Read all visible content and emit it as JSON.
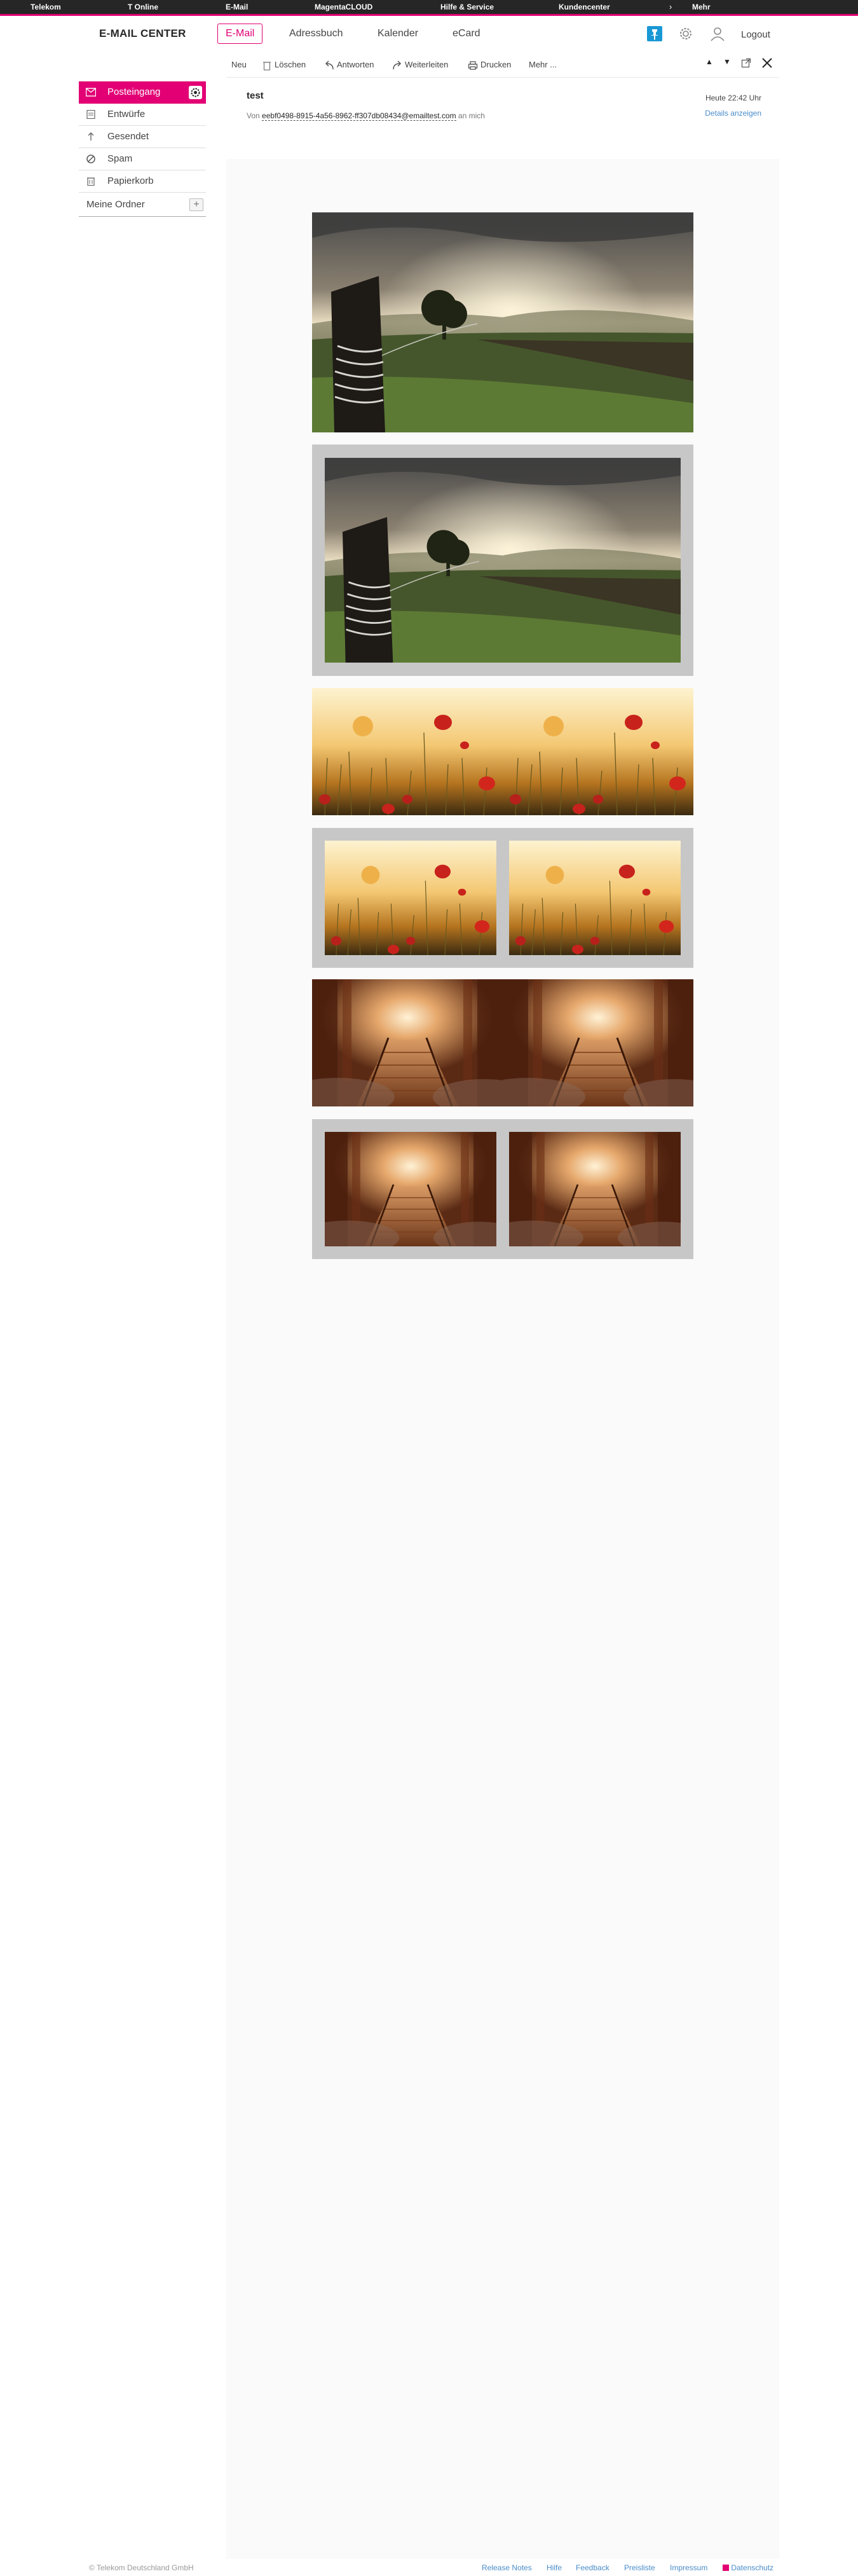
{
  "topbar": {
    "items": [
      "Telekom",
      "T Online",
      "E-Mail",
      "MagentaCLOUD",
      "Hilfe & Service",
      "Kundencenter",
      "Mehr"
    ]
  },
  "header": {
    "brand": "E-MAIL CENTER",
    "tabs": [
      "E-Mail",
      "Adressbuch",
      "Kalender",
      "eCard"
    ],
    "logout": "Logout"
  },
  "sidebar": {
    "items": [
      "Posteingang",
      "Entwürfe",
      "Gesendet",
      "Spam",
      "Papierkorb"
    ],
    "folders_label": "Meine Ordner",
    "add_label": "+"
  },
  "toolbar": {
    "new": "Neu",
    "delete": "Löschen",
    "reply": "Antworten",
    "forward": "Weiterleiten",
    "print": "Drucken",
    "more": "Mehr ..."
  },
  "message": {
    "subject": "test",
    "date": "Heute 22:42 Uhr",
    "details_link": "Details anzeigen",
    "from_prefix": "Von",
    "sender": "eebf0498-8915-4a56-8962-ff307db08434@emailtest.com",
    "to_suffix": "an mich"
  },
  "images": [
    {
      "subject": "field-fence-sunset",
      "layout": "single"
    },
    {
      "subject": "field-fence-sunset",
      "layout": "single-framed"
    },
    {
      "subject": "poppies",
      "layout": "pair"
    },
    {
      "subject": "poppies",
      "layout": "pair-framed"
    },
    {
      "subject": "forest-bridge",
      "layout": "pair"
    },
    {
      "subject": "forest-bridge",
      "layout": "pair-framed"
    }
  ],
  "footer": {
    "copyright": "© Telekom Deutschland GmbH",
    "links": [
      "Release Notes",
      "Hilfe",
      "Feedback",
      "Preisliste",
      "Impressum",
      "Datenschutz"
    ]
  },
  "colors": {
    "brand": "#e20074",
    "topbar": "#262626",
    "link": "#4a8cc9",
    "frame": "#c7c7c7",
    "active_icon": "#1a98d5"
  }
}
